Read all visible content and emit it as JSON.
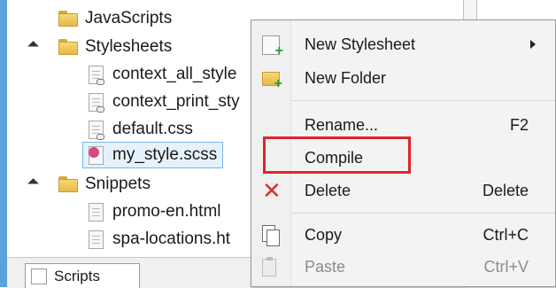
{
  "tree": {
    "items": [
      {
        "label": "JavaScripts",
        "type": "folder"
      },
      {
        "label": "Stylesheets",
        "type": "folder",
        "expanded": true
      },
      {
        "label": "context_all_style",
        "type": "file-link"
      },
      {
        "label": "context_print_sty",
        "type": "file-link"
      },
      {
        "label": "default.css",
        "type": "file-link"
      },
      {
        "label": "my_style.scss",
        "type": "scss",
        "selected": true
      },
      {
        "label": "Snippets",
        "type": "folder",
        "expanded": true
      },
      {
        "label": "promo-en.html",
        "type": "file"
      },
      {
        "label": "spa-locations.ht",
        "type": "file"
      }
    ]
  },
  "bottom_tab": {
    "label": "Scripts"
  },
  "context_menu": {
    "items": [
      {
        "label": "New Stylesheet",
        "icon": "new-stylesheet-icon",
        "submenu": true
      },
      {
        "label": "New Folder",
        "icon": "new-folder-icon"
      },
      {
        "label": "Rename...",
        "shortcut": "F2"
      },
      {
        "label": "Compile",
        "highlighted": true
      },
      {
        "label": "Delete",
        "icon": "delete-icon",
        "shortcut": "Delete"
      },
      {
        "label": "Copy",
        "icon": "copy-icon",
        "shortcut": "Ctrl+C"
      },
      {
        "label": "Paste",
        "icon": "paste-icon",
        "shortcut": "Ctrl+V",
        "disabled": true
      }
    ]
  },
  "colors": {
    "accent": "#5aa3dc",
    "highlight_border": "#e0242b",
    "selection_bg": "#e5f1fb"
  }
}
